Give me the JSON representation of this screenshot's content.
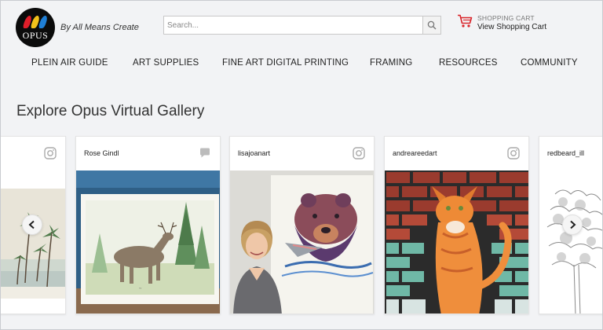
{
  "brand": {
    "logo_text": "OPUS",
    "tagline": "By All Means Create",
    "feather_colors": [
      "#e01e2a",
      "#f2c21b",
      "#1f7fd6"
    ]
  },
  "search": {
    "placeholder": "Search...",
    "value": ""
  },
  "cart": {
    "label": "SHOPPING CART",
    "link": "View Shopping Cart",
    "icon": "shopping-cart-icon",
    "color": "#d9262c"
  },
  "nav": {
    "items": [
      {
        "label": "PLEIN AIR GUIDE"
      },
      {
        "label": "ART SUPPLIES"
      },
      {
        "label": "FINE ART DIGITAL PRINTING"
      },
      {
        "label": "FRAMING"
      },
      {
        "label": "RESOURCES"
      },
      {
        "label": "COMMUNITY"
      }
    ]
  },
  "gallery": {
    "title": "Explore Opus Virtual Gallery",
    "cards": [
      {
        "user": "",
        "social_icon": "instagram-icon",
        "image": "palm-trees-watercolor"
      },
      {
        "user": "Rose Gindl",
        "social_icon": "comment-icon",
        "image": "deer-watercolor"
      },
      {
        "user": "lisajoanart",
        "social_icon": "instagram-icon",
        "image": "artist-with-bear-painting"
      },
      {
        "user": "andreareedart",
        "social_icon": "instagram-icon",
        "image": "cat-on-brick-wall"
      },
      {
        "user": "redbeard_ill",
        "social_icon": "",
        "image": "pencil-tree-drawing"
      }
    ],
    "prev_icon": "chevron-left-icon",
    "next_icon": "chevron-right-icon"
  }
}
